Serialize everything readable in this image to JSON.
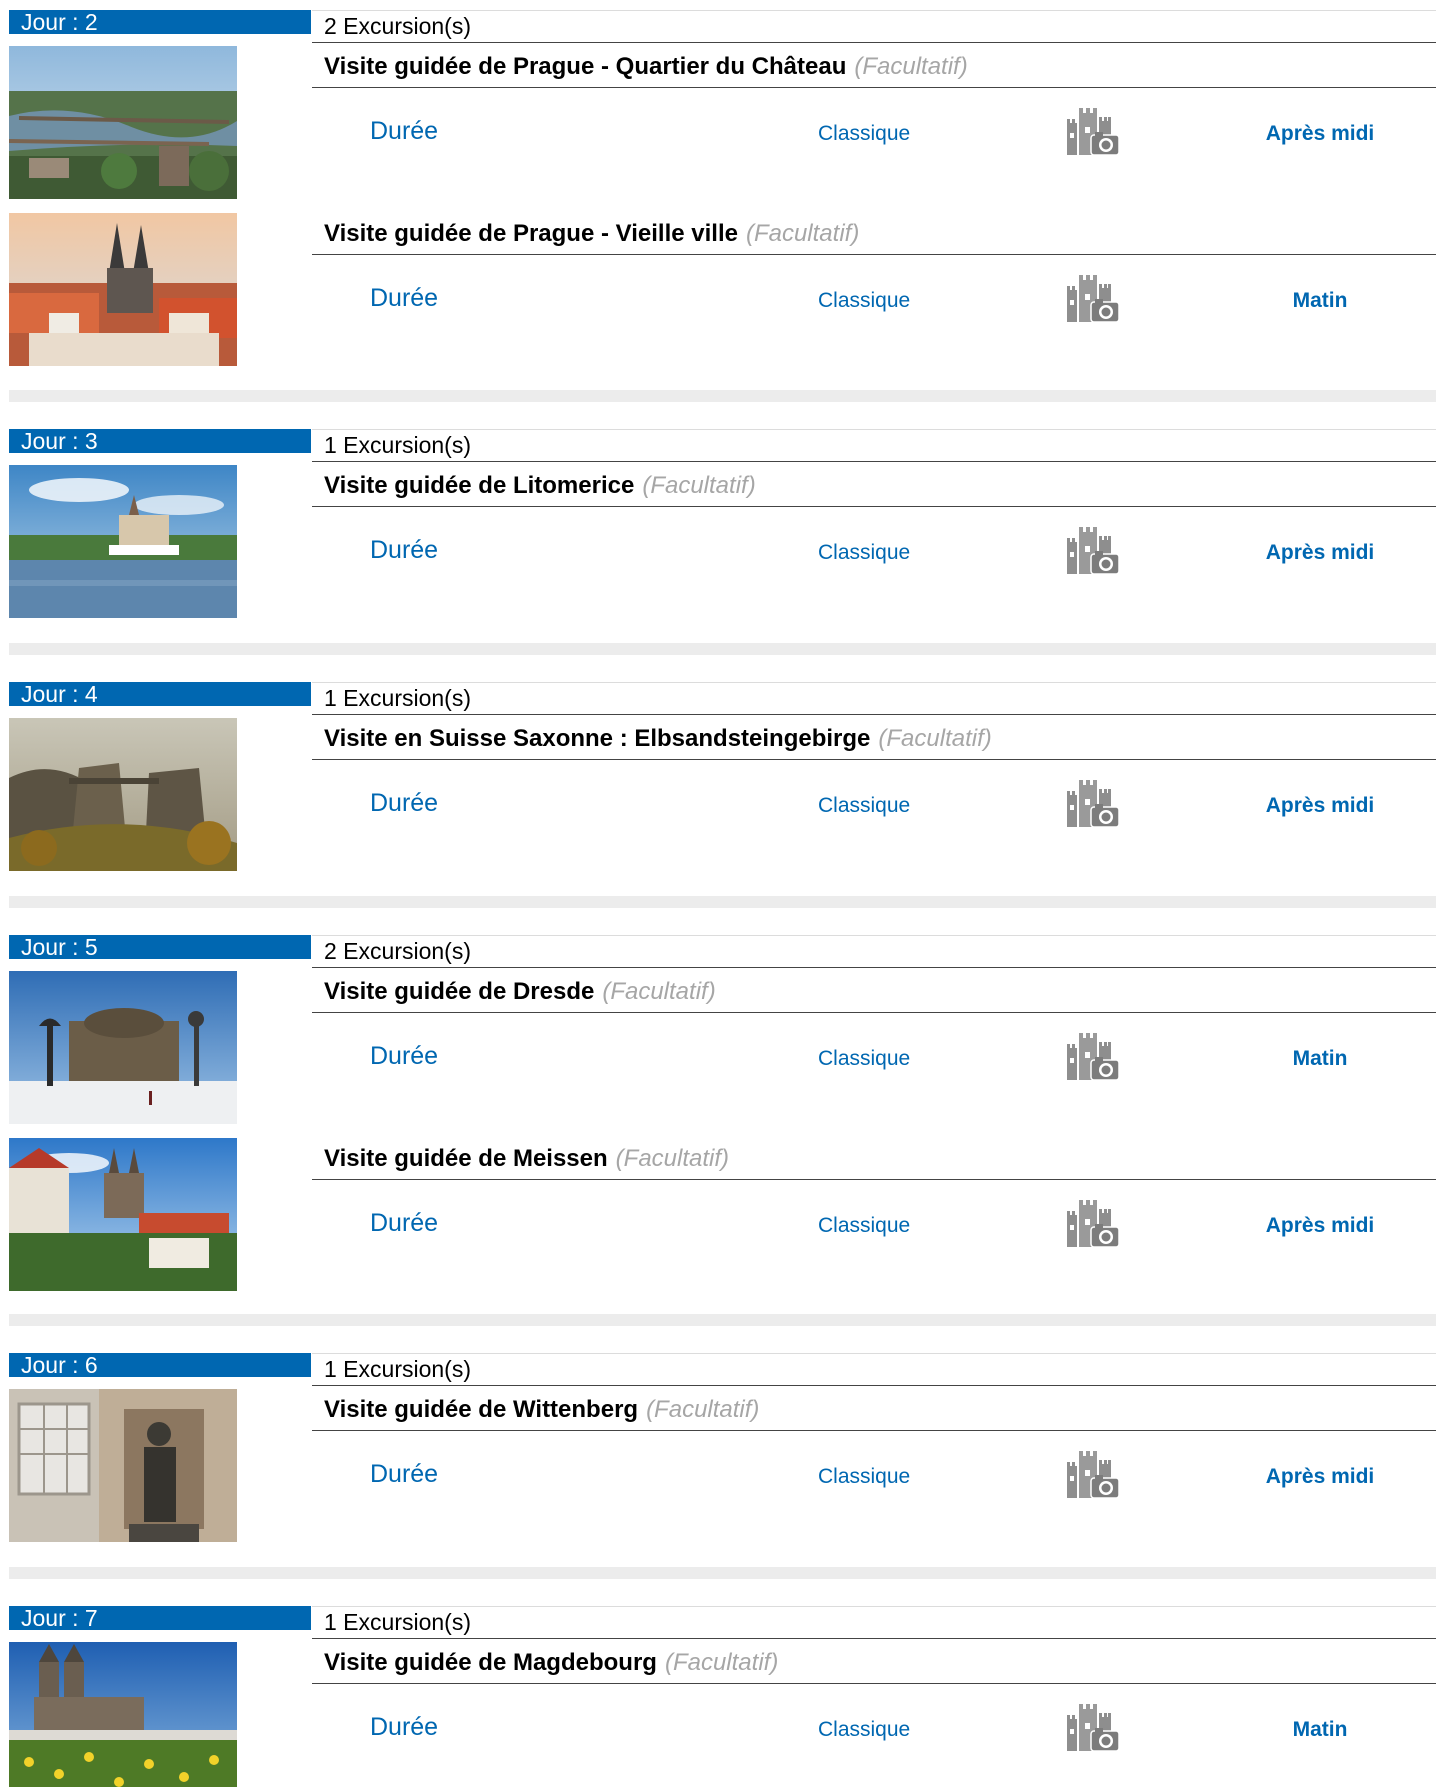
{
  "days": [
    {
      "label": "Jour : 2",
      "count": "2 Excursion(s)",
      "excursions": [
        {
          "title": "Visite guidée de Prague - Quartier du Château",
          "optional": "(Facultatif)",
          "duration_label": "Durée",
          "type": "Classique",
          "theme_icon": "castle-camera-icon",
          "period": "Après midi",
          "image": "prague-bridges-photo"
        },
        {
          "title": "Visite guidée de Prague - Vieille ville",
          "optional": "(Facultatif)",
          "duration_label": "Durée",
          "type": "Classique",
          "theme_icon": "castle-camera-icon",
          "period": "Matin",
          "image": "prague-old-town-photo"
        }
      ]
    },
    {
      "label": "Jour : 3",
      "count": "1 Excursion(s)",
      "excursions": [
        {
          "title": "Visite guidée de Litomerice",
          "optional": "(Facultatif)",
          "duration_label": "Durée",
          "type": "Classique",
          "theme_icon": "castle-camera-icon",
          "period": "Après midi",
          "image": "litomerice-river-photo"
        }
      ]
    },
    {
      "label": "Jour : 4",
      "count": "1 Excursion(s)",
      "excursions": [
        {
          "title": "Visite en Suisse Saxonne : Elbsandsteingebirge",
          "optional": "(Facultatif)",
          "duration_label": "Durée",
          "type": "Classique",
          "theme_icon": "castle-camera-icon",
          "period": "Après midi",
          "image": "saxon-switzerland-rocks-photo"
        }
      ]
    },
    {
      "label": "Jour : 5",
      "count": "2 Excursion(s)",
      "excursions": [
        {
          "title": "Visite guidée de Dresde",
          "optional": "(Facultatif)",
          "duration_label": "Durée",
          "type": "Classique",
          "theme_icon": "castle-camera-icon",
          "period": "Matin",
          "image": "dresden-opera-photo"
        },
        {
          "title": "Visite guidée de Meissen",
          "optional": "(Facultatif)",
          "duration_label": "Durée",
          "type": "Classique",
          "theme_icon": "castle-camera-icon",
          "period": "Après midi",
          "image": "meissen-castle-photo"
        }
      ]
    },
    {
      "label": "Jour : 6",
      "count": "1 Excursion(s)",
      "excursions": [
        {
          "title": "Visite guidée de Wittenberg",
          "optional": "(Facultatif)",
          "duration_label": "Durée",
          "type": "Classique",
          "theme_icon": "castle-camera-icon",
          "period": "Après midi",
          "image": "wittenberg-statue-photo"
        }
      ]
    },
    {
      "label": "Jour : 7",
      "count": "1 Excursion(s)",
      "excursions": [
        {
          "title": "Visite guidée de Magdebourg",
          "optional": "(Facultatif)",
          "duration_label": "Durée",
          "type": "Classique",
          "theme_icon": "castle-camera-icon",
          "period": "Matin",
          "image": "magdeburg-cathedral-photo"
        }
      ]
    }
  ],
  "colors": {
    "accent": "#0067b1",
    "optional_text": "#a6a6a6",
    "separator": "#ececec"
  }
}
